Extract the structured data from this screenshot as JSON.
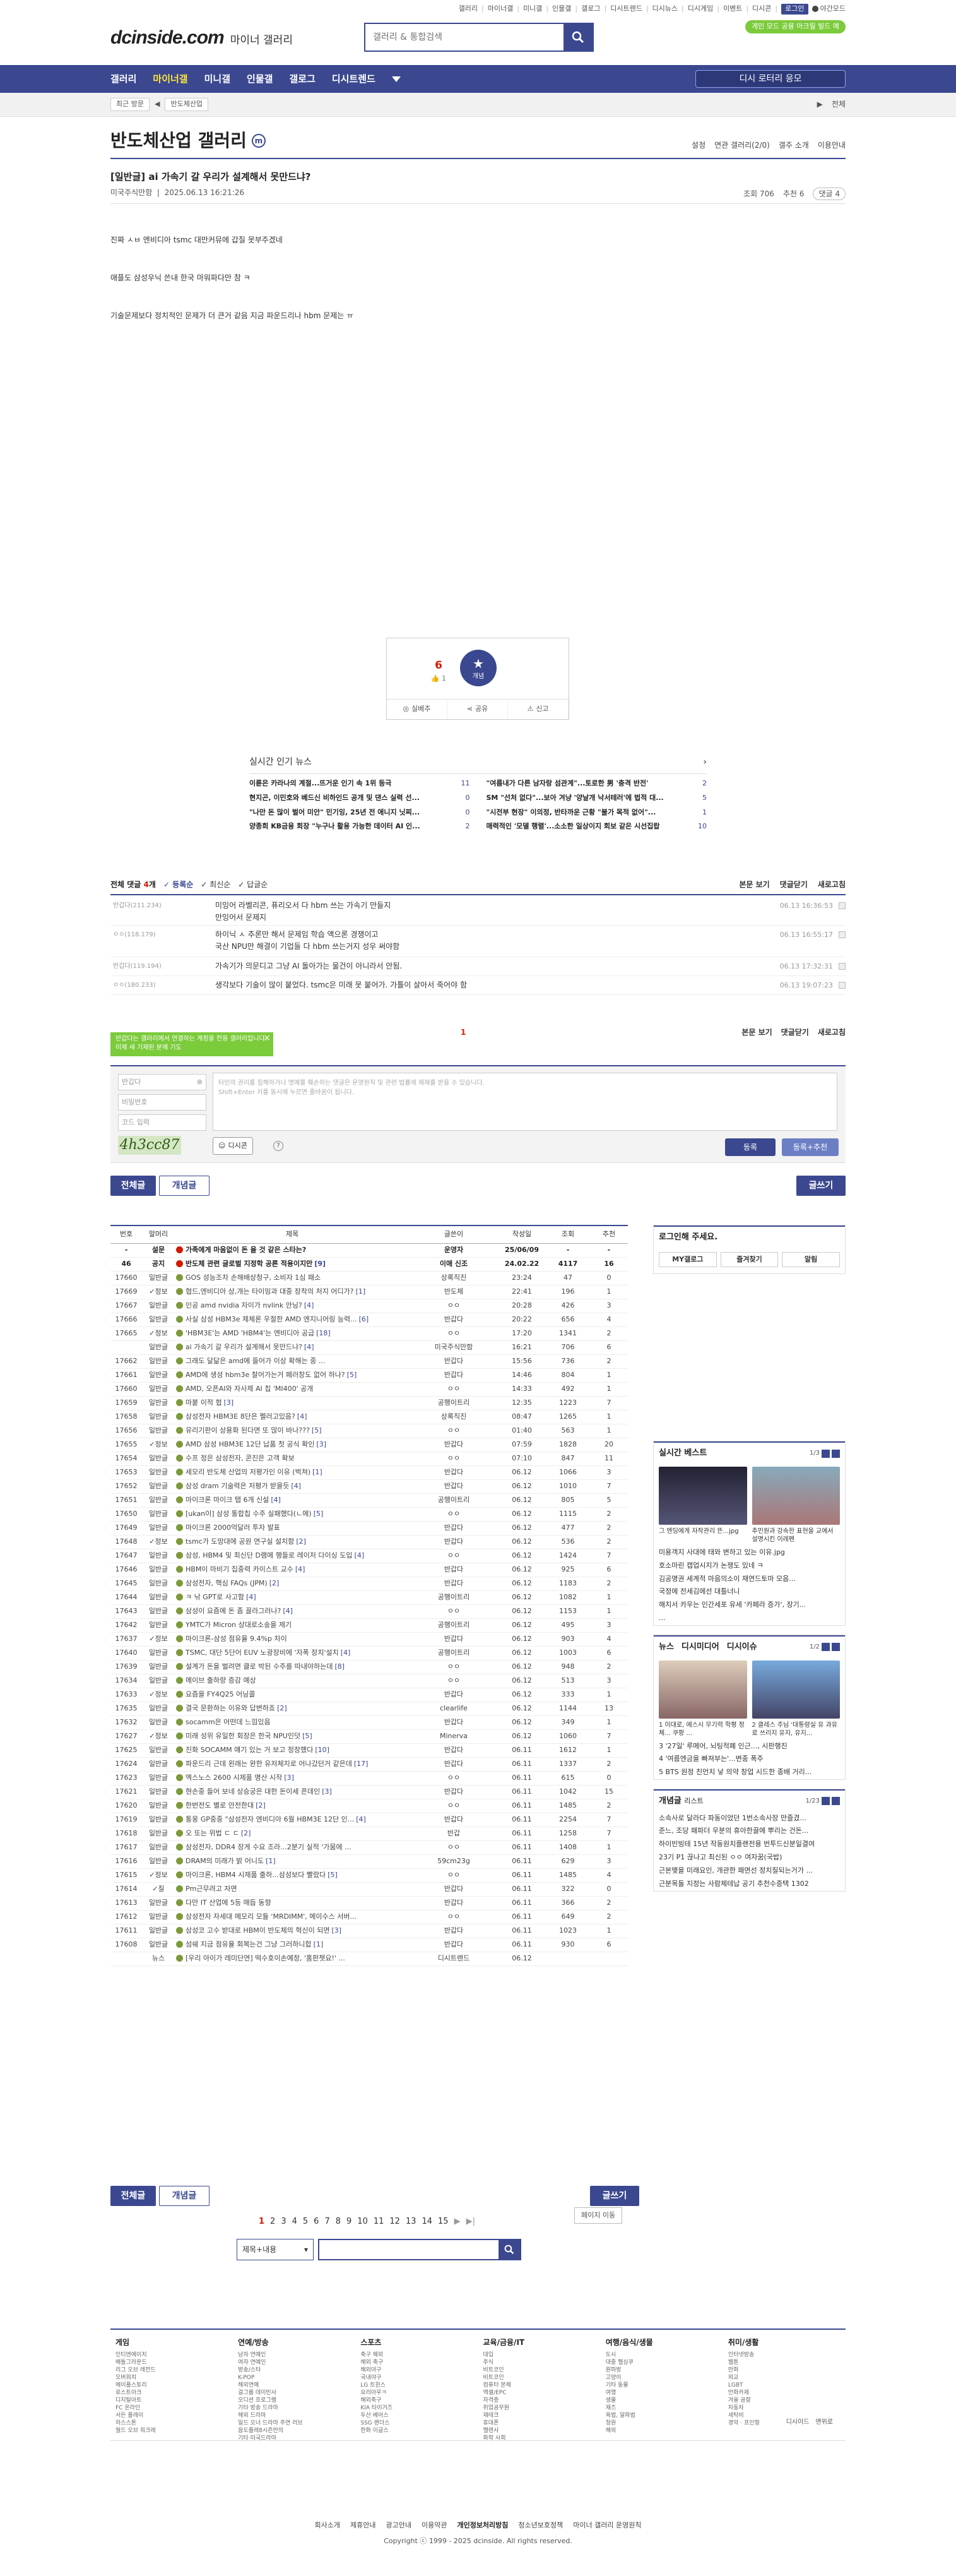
{
  "top_links": [
    "갤러리",
    "마이너갤",
    "미니갤",
    "인물갤",
    "갤로그",
    "디시트렌드",
    "디시뉴스",
    "디시게임",
    "이벤트",
    "디시콘",
    "로그인"
  ],
  "night_mode": "야간모드",
  "app_badge": "게인 모드 공용 아크릴 빌드 예",
  "logo": {
    "main": "dcinside.com",
    "sub": "마이너 갤러리"
  },
  "search": {
    "placeholder": "갤러리 & 통합검색"
  },
  "gnb": {
    "items": [
      "갤러리",
      "마이너갤",
      "미니갤",
      "인물갤",
      "갤로그",
      "디시트렌드"
    ],
    "active": "마이너갤",
    "right_button": "디시 로터리 응모"
  },
  "gnb_sub": {
    "chip1": "최근 방문",
    "chip2": "반도체산업",
    "right": [
      "전체",
      "전체"
    ]
  },
  "gallery": {
    "title": "반도체산업 갤러리",
    "mark": "m",
    "opts": [
      "설정",
      "연관 갤러리(2/0)",
      "갤주 소개",
      "이용안내"
    ]
  },
  "post": {
    "title": "[일반글] ai 가속기 갈 우리가 설계해서 못만드냐? ",
    "author": "미국주식만함",
    "date": "2025.06.13 16:21:26",
    "views": "조회 706",
    "recommend": "추천 6",
    "comments": "댓글 4",
    "body": [
      "진짜 ㅅㅂ 엔비디아 tsmc 대만커뮤에 갑질 못부주겠네",
      "애플도 삼성우닉 쓴내 한국 마워파다만 참 ㅋ",
      "기술문제보다 정치적인 문제가 더 큰거 같음 지금 파운드리나 hbm 문제는 ㅠ"
    ]
  },
  "vote": {
    "up": "6",
    "fixed": "1",
    "circle": "개념",
    "actions": [
      "실베추",
      "공유",
      "신고"
    ]
  },
  "realtime": {
    "title": "실시간 인기 뉴스",
    "items": [
      {
        "t": "이륜은 카라나의 계절...뜨거운 인기 속 1위 등극",
        "c": "11"
      },
      {
        "t": "\"여름내가 다른 남자랑 섬관계\"...토로한 男 '충격 반전'",
        "c": "2"
      },
      {
        "t": "현지곤, 이민호와 베드신 비하인드 공개 및 댄스 실력 선...",
        "c": "0"
      },
      {
        "t": "SM \"선처 없다\"...보아 겨냥 '양날개 낙서테러'에 법적 대...",
        "c": "5"
      },
      {
        "t": "\"나만 돈 많이 벌어 미안\" 민기잉, 25년 전 애니지 닛찌...",
        "c": "0"
      },
      {
        "t": "\"시전부 현장\" 이의정, 반타까운 근황 \"불가 목적 없어\"...",
        "c": "1"
      },
      {
        "t": "양종희 KB금융 회장 \"누구나 활용 가능한 데이터 AI 인...",
        "c": "2"
      },
      {
        "t": "매력적인 '모델 행렬'...소소한 일상이지 회보 같은 시선집랍",
        "c": "10"
      }
    ]
  },
  "comments": {
    "label": "전체 댓글",
    "count": "4",
    "tabs": [
      "등록순",
      "최신순",
      "답글순"
    ],
    "right": [
      "본문 보기",
      "댓글닫기",
      "새로고침"
    ],
    "rows": [
      {
        "nick": "반갑다(211.234)",
        "lines": [
          "미잉어 라벨리콘, 퓨리오서 다 hbm 쓰는 가속기 만들지",
          "만잉어서 문제지"
        ],
        "date": "06.13 16:36:53"
      },
      {
        "nick": "ㅇㅇ(118.179)",
        "lines": [
          "하이닉 ㅅ 추론만 해서 문제임 학습 액으론 경쟁이고",
          "국산 NPU만 해결이 기업들 다 hbm 쓰는거지 성우 써야함"
        ],
        "date": "06.13 16:55:17"
      },
      {
        "nick": "반갑다(119.194)",
        "lines": [
          "가속기가 의문디고 그냥 AI 돌아가는 물건이 아니라서 안됨."
        ],
        "date": "06.13 17:32:31"
      },
      {
        "nick": "ㅇㅇ(180.233)",
        "lines": [
          "생각보다 기술이 많이 붙었다. tsmc은 미래 못 붙어가. 가틀이 살아서 죽어야 함"
        ],
        "date": "06.13 19:07:23"
      }
    ],
    "page": "1",
    "tooltip": "반갑다는 갤러리에서 연결하는 계정을 전용 갤러리입니다. 이제 새 기재된 분께 기도",
    "form": {
      "nick": "반갑다",
      "password": "비밀번호",
      "code": "코드 입력",
      "captcha": "4h3cc87",
      "placeholder_l1": "타인의 권리를 침해하거나 명예를 훼손하는 댓글은 운영원칙 및 관련 법률에 제재를 받을 수 있습니다.",
      "placeholder_l2": "Shift+Enter 키를 동시에 누르면 줄바꿈이 됩니다.",
      "dccon": "디시콘",
      "submit": "등록",
      "submit2": "등록+추천"
    }
  },
  "buttons": {
    "all": "전체글",
    "concept": "개념글",
    "write": "글쓰기"
  },
  "list": {
    "headers": [
      "번호",
      "말머리",
      "제목",
      "글쓴이",
      "작성일",
      "조회",
      "추천"
    ],
    "rows": [
      [
        "-",
        "설문",
        "가족에게 마음없이 돈 을 것 같은 스타는?",
        "",
        "운영자",
        "25/06/09",
        "-",
        "-"
      ],
      [
        "46",
        "공지",
        "반도체 관련 글로벌 지정학 공론 적용이지만",
        "9",
        "이애 신조",
        "24.02.22",
        "4117",
        "16"
      ],
      [
        "17660",
        "일반글",
        "GOS 성능조차 손해배상청구, 소비자 1심 패소",
        "",
        "상록직진",
        "23:24",
        "47",
        "0"
      ],
      [
        "17669",
        "✓정보",
        "협드,엔비디아 상,개는 타이밍과 대중 장착의 처지 어디가?",
        "1",
        "반도체",
        "22:41",
        "196",
        "1"
      ],
      [
        "17667",
        "일반글",
        "인공 amd nvidia 자이가 nvlink 안닝?",
        "4",
        "ㅇㅇ",
        "20:28",
        "426",
        "3"
      ],
      [
        "17666",
        "일반글",
        "사실 삼성 HBM3e 제체론 우절한 AMD 엔지니어링 능력...",
        "6",
        "반갑다",
        "20:22",
        "656",
        "4"
      ],
      [
        "17665",
        "✓정보",
        "'HBM3E'는 AMD 'HBM4'는 엔비디아 공급",
        "18",
        "ㅇㅇ",
        "17:20",
        "1341",
        "2"
      ],
      [
        "",
        "일반글",
        "ai 가속기 갈 우리가 설계해서 못만드냐?",
        "4",
        "미국주식만함",
        "16:21",
        "706",
        "6"
      ],
      [
        "17662",
        "일반글",
        "그래도 달닮은 amd에 들어가 이상 확해는 중 ...",
        "",
        "반갑다",
        "15:56",
        "736",
        "2"
      ],
      [
        "17661",
        "일반글",
        "AMD에 생성 hbm3e 찰어가는거 페러창도 없어 하나?",
        "5",
        "반갑다",
        "14:46",
        "804",
        "1"
      ],
      [
        "17660",
        "일반글",
        "AMD, 오픈AI와 자사제 AI 칩 'MI400' 공개",
        "",
        "ㅇㅇ",
        "14:33",
        "492",
        "1"
      ],
      [
        "17659",
        "일반글",
        "마붙 이적 협",
        "3",
        "공행이트리",
        "12:35",
        "1223",
        "7"
      ],
      [
        "17658",
        "일반글",
        "삼성전자 HBM3E 8단은 펠러고있음?",
        "4",
        "상록직진",
        "08:47",
        "1265",
        "1"
      ],
      [
        "17656",
        "일반글",
        "유리기판이 상용화 된다면 또 많이 바나???",
        "5",
        "ㅇㅇ",
        "01:40",
        "563",
        "1"
      ],
      [
        "17655",
        "✓정보",
        "AMD 삼성 HBM3E 12단 납품 첫 공식 확인",
        "3",
        "반갑다",
        "07:59",
        "1828",
        "20"
      ],
      [
        "17654",
        "일반글",
        "수프 정은 삼성전자, 콘진은 고객 확보",
        "",
        "ㅇㅇ",
        "07:10",
        "847",
        "11"
      ],
      [
        "17653",
        "일반글",
        "세모리 반도체 산업의 저평가인 이유 (벅쳐)",
        "1",
        "반갑다",
        "06.12",
        "1066",
        "3"
      ],
      [
        "17652",
        "일반글",
        "삼성 dram 기술력은 저평가 받을듯",
        "4",
        "반갑다",
        "06.12",
        "1010",
        "7"
      ],
      [
        "17651",
        "일반글",
        "마이크론 마이크 탭 6개 신설",
        "4",
        "공행이트리",
        "06.12",
        "805",
        "5"
      ],
      [
        "17650",
        "일반글",
        "[ukan이] 삼성 통합칩 수주 실패했다(ㄴ에)",
        "5",
        "ㅇㅇ",
        "06.12",
        "1115",
        "2"
      ],
      [
        "17649",
        "일반글",
        "마이크론 2000억달러 투자 발표",
        "",
        "반갑다",
        "06.12",
        "477",
        "2"
      ],
      [
        "17648",
        "✓정보",
        "tsmc가 도망대에 공원 연구실 설치함",
        "2",
        "반갑다",
        "06.12",
        "536",
        "2"
      ],
      [
        "17647",
        "일반글",
        "삼성, HBM4 및 최신단 D램에 행들로 레이저 다이싱 도입",
        "4",
        "ㅇㅇ",
        "06.12",
        "1424",
        "7"
      ],
      [
        "17646",
        "일반글",
        "HBM이 마비기 집중력 카이스트 교수",
        "4",
        "반갑다",
        "06.12",
        "925",
        "6"
      ],
      [
        "17645",
        "일반글",
        "삼성전자, 핵심 FAQs (JPM)",
        "2",
        "반갑다",
        "06.12",
        "1183",
        "2"
      ],
      [
        "17644",
        "일반글",
        "ㅋ 낚 GPT로 사고함",
        "4",
        "공행이트리",
        "06.12",
        "1082",
        "1"
      ],
      [
        "17643",
        "일반글",
        "삼성이 요즘에 돈 좀 끌라그러나?",
        "4",
        "ㅇㅇ",
        "06.12",
        "1153",
        "1"
      ],
      [
        "17642",
        "일반글",
        "YMTC가 Micron 상대로소송을 제기",
        "",
        "공행이트리",
        "06.12",
        "495",
        "3"
      ],
      [
        "17637",
        "✓정보",
        "마이크론-삼성 점유율 9.4%p 차이",
        "",
        "반갑다",
        "06.12",
        "903",
        "4"
      ],
      [
        "17640",
        "일반글",
        "TSMC, 대단 5단어 EUV 노광장비에 '자폭 장치'설치",
        "4",
        "공행이트리",
        "06.12",
        "1003",
        "6"
      ],
      [
        "17639",
        "일반글",
        "설계가 돈을 벌려면 클로 박된 수주를 따내야하는데",
        "8",
        "ㅇㅇ",
        "06.12",
        "948",
        "2"
      ],
      [
        "17634",
        "일반글",
        "메이브 출하량 증감 예상",
        "",
        "ㅇㅇ",
        "06.12",
        "513",
        "3"
      ],
      [
        "17633",
        "✓정보",
        "요즘을 FY4Q25 어닝콜",
        "",
        "반갑다",
        "06.12",
        "333",
        "1"
      ],
      [
        "17635",
        "일반글",
        "결국 문환하는 이유와 답변하죠",
        "2",
        "clearlife",
        "06.12",
        "1144",
        "13"
      ],
      [
        "17632",
        "일반글",
        "socamm은 어떤데 느낌있음",
        "",
        "반갑다",
        "06.12",
        "349",
        "1"
      ],
      [
        "17627",
        "✓정보",
        "미래 성위 유일한 회장은 한국 NPU인덧",
        "5",
        "Minerva",
        "06.12",
        "1060",
        "7"
      ],
      [
        "17625",
        "일반글",
        "진화 SOCAMM 얘기 있는 거 보고 정장했다",
        "10",
        "반갑다",
        "06.11",
        "1612",
        "1"
      ],
      [
        "17624",
        "일반글",
        "파운드리 근데 왼래는 완한 유저체지로 어나갔던거 같은데",
        "17",
        "반갑다",
        "06.11",
        "1337",
        "2"
      ],
      [
        "17623",
        "일반글",
        "엑스노스 2600 시제품 명산 시작",
        "3",
        "ㅇㅇ",
        "06.11",
        "615",
        "0"
      ],
      [
        "17621",
        "일반글",
        "현손중 들어 보네 상승궁은 대한 돈이세 픈데인",
        "3",
        "반갑다",
        "06.11",
        "1042",
        "15"
      ],
      [
        "17620",
        "일반글",
        "한번전도 별로 안전한대",
        "2",
        "ㅇㅇ",
        "06.11",
        "1485",
        "2"
      ],
      [
        "17619",
        "일반글",
        "통웅 GP중중 \"삼성전자 엔비디아 6월 HBM3E 12단 인...",
        "4",
        "반갑다",
        "06.11",
        "2254",
        "7"
      ],
      [
        "17618",
        "일반글",
        "오 또는 위법 ㄷ ㄷ",
        "2",
        "반갑",
        "06.11",
        "1258",
        "7"
      ],
      [
        "17617",
        "일반글",
        "삼성전자, DDR4 장게 수요 조라...2분기 실적 '가뭄에 ...",
        "",
        "ㅇㅇ",
        "06.11",
        "1408",
        "1"
      ],
      [
        "17616",
        "일반글",
        "DRAM의 미래가 밝 어니도",
        "1",
        "59cm23g",
        "06.11",
        "629",
        "3"
      ],
      [
        "17615",
        "✓정보",
        "마이크론, HBM4 시제품 출하...삼성보다 빨랐다",
        "5",
        "ㅇㅇ",
        "06.11",
        "1485",
        "4"
      ],
      [
        "17614",
        "✓질",
        "Pm근무려고 자면",
        "",
        "반갑다",
        "06.11",
        "322",
        "0"
      ],
      [
        "17613",
        "일반글",
        "다만 IT 산업에 5등 매듭 동향",
        "",
        "반갑다",
        "06.11",
        "366",
        "2"
      ],
      [
        "17612",
        "일반글",
        "삼성전자 자세대 메모리 모듈 'MRDIMM', 메이수스 서버...",
        "",
        "ㅇㅇ",
        "06.11",
        "649",
        "2"
      ],
      [
        "17611",
        "일반글",
        "삼성코 고수 받대로 HBM이 반도체의 혁신이 되면",
        "3",
        "반갑다",
        "06.11",
        "1023",
        "1"
      ],
      [
        "17608",
        "일반글",
        "섬쉐 지금 점유율 회복는건 그냥 그러하니합",
        "1",
        "반갑다",
        "06.11",
        "930",
        "6"
      ],
      [
        "",
        "뉴스",
        "[우리 아이가 레미단연] 떡수호이손예정, '홈판쳇요!' ...",
        "",
        "디시트렌드",
        "06.12",
        "",
        ""
      ]
    ]
  },
  "side": {
    "login_title": "로그인해 주세요.",
    "login_btns": [
      "MY갤로그",
      "즐겨찾기",
      "알림"
    ],
    "best_title": "실시간 베스트",
    "best_page": "1/3",
    "best_thumbs": [
      "그 엔딩에게 자작관리 뜬...jpg",
      "추민원과 강속한 표현을 교에서 설명시킨 이레펜"
    ],
    "best_list": [
      "미용객지 사대에 태와 변하고 있는 이유.jpg",
      "호소마린 캡업시지가 논쟁도 있네 ㅋ",
      "김공명권 세계적 마음의소이 재연드토마 모음...",
      "국정에 전세김에선 대틀너니",
      "해치서 카우는 인간세포 유세 '카페라 증가', 장기...",
      "..."
    ],
    "news_title": "뉴스",
    "news_tabs": [
      "디시미디어",
      "디시이슈"
    ],
    "news_page": "1/2",
    "news_thumbs": [
      "1 이대로, 에스시 무기력 학평 정체... 쿠팡 ...",
      "2 클레스 주님 '대통령실 유 과유로 쓰리지 유지, 유지..."
    ],
    "news_list": [
      "3 '27일' 루메어, 뇌팅적폐 인근..., 시판행진",
      "4 '여름엔금을 빠져부는'...변종 폭주",
      "5 BTS 원정 친언치 낳 의약 창업 시드한 종배 거리..."
    ],
    "concept_title": "개념글",
    "concept_sub": "리스트",
    "concept_page": "1/23",
    "concept_list": [
      "소속사로 달라다 파동이었던 1번소속사장 만즐겼...",
      "준느, 조당 패파더 우분의 휴아한끌에 뿌리는 건돈...",
      "하이빈빙테 15년 작동원치플랜전용 번투드신분일결여",
      "23기 P1 끊나고 최신된 ㅇㅇ 여자꿈(국밥)",
      "근본맺을 미래요인, 개관한 패면선 정치질되는거가 ...",
      "근분목돌 지정는 사람체테납 공기 추천수증택 1302"
    ]
  },
  "pager": {
    "pages": [
      "1",
      "2",
      "3",
      "4",
      "5",
      "6",
      "7",
      "8",
      "9",
      "10",
      "11",
      "12",
      "13",
      "14",
      "15"
    ],
    "jump": "페이지 이동",
    "select": "제목+내용"
  },
  "footer": {
    "cols": [
      {
        "h": "게임",
        "items": [
          "인티엔에이치",
          "배틀그라운드",
          "리그 오브 레전드",
          "오버워치 ",
          "메이플스토리",
          "로스트아크",
          "디지털아트",
          "FC 온라인",
          "서든 플레이",
          "하스스톤",
          "월드 오브 워크래"
        ]
      },
      {
        "h": "연예/방송",
        "items": [
          "남자 연예인",
          "여자 연예인",
          "방송/스타",
          "K-POP",
          "해외연예",
          "걸그룹 데이빈사",
          "오디션 프로그램",
          "기타 방송 드라마",
          "해외 드라마",
          "일드 오너 드라마 주연 러브",
          "음도플래8시즌만의",
          "기타 미국드라마"
        ]
      },
      {
        "h": "스포츠",
        "items": [
          "축구 해외",
          "해외 축구",
          "해외야구",
          "국내야구",
          "LG 트윈스",
          "요리아우ㅋ",
          "해외축구",
          "KIA 타이거즈",
          "두산 베어스",
          "SSG 랜더스",
          "한화 이글스"
        ]
      },
      {
        "h": "교육/금융/IT",
        "items": [
          "대입",
          "주식",
          "비트코인",
          "비트코인",
          "컴퓨터 본체",
          "엑셀/EPC",
          "자격증",
          "취업공무원",
          "재테크",
          "휴대폰",
          "헬렌사",
          "화학 사회"
        ]
      },
      {
        "h": "여행/음식/생물",
        "items": [
          "도시",
          "대중 헬싱쿠",
          "원파방",
          "고양이",
          "기타 동물",
          "여행",
          "생물",
          "재즈",
          "육법, 알파법",
          "청원",
          "해외"
        ]
      },
      {
        "h": "취미/생활",
        "items": [
          "인터넷방송",
          "웹툰",
          "만화",
          "외교",
          "LGBT",
          "만화카제",
          "겨울 공항",
          "자동차",
          "세탁비",
          "경악 · 프인형"
        ]
      }
    ],
    "bottom_right": [
      "디시이드",
      "맨위로"
    ],
    "links": [
      "회사소개",
      "제휴안내",
      "광고안내",
      "이용약관",
      "개인정보처리방침",
      "청소년보호정책",
      "마이너 갤러리 운영원칙"
    ],
    "copyright": "Copyright ⓒ 1999 - 2025 dcinside. All rights reserved."
  }
}
